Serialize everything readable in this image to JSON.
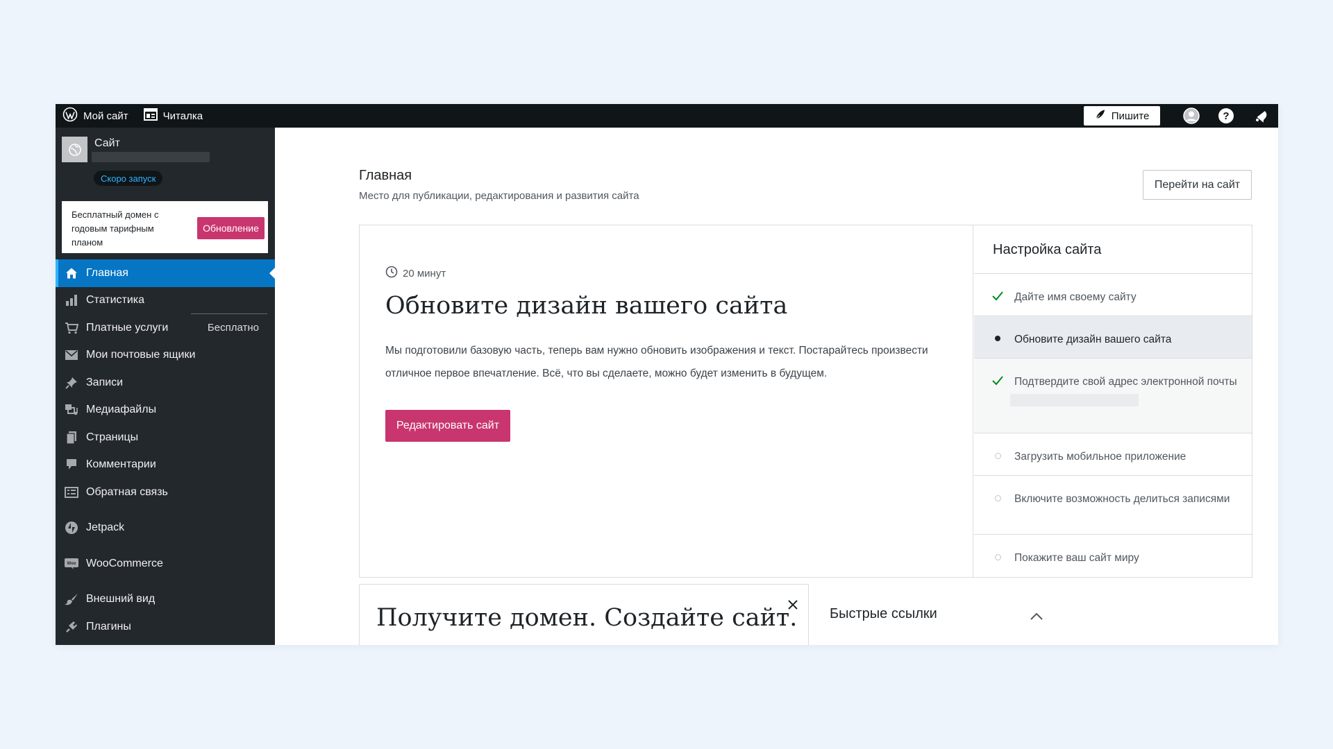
{
  "topbar": {
    "my_site_label": "Мой сайт",
    "reader_label": "Читалка",
    "write_label": "Пишите",
    "icons": [
      "wordpress-logo-icon",
      "reader-icon",
      "pen-icon",
      "user-avatar-icon",
      "help-icon",
      "notifications-icon"
    ]
  },
  "sidebar": {
    "site_name": "Сайт",
    "launch_badge": "Скоро запуск",
    "promo_text": "Бесплатный домен с годовым тарифным планом",
    "promo_button": "Обновление",
    "items": [
      {
        "label": "Главная",
        "icon": "home-icon",
        "active": true
      },
      {
        "label": "Статистика",
        "icon": "stats-icon"
      },
      {
        "label": "Платные услуги",
        "icon": "cart-icon",
        "note": "Бесплатно"
      },
      {
        "label": "Мои почтовые ящики",
        "icon": "mail-icon"
      },
      {
        "label": "Записи",
        "icon": "pin-icon"
      },
      {
        "label": "Медиафайлы",
        "icon": "media-icon"
      },
      {
        "label": "Страницы",
        "icon": "pages-icon"
      },
      {
        "label": "Комментарии",
        "icon": "comment-icon"
      },
      {
        "label": "Обратная связь",
        "icon": "feedback-icon"
      },
      {
        "label": "Jetpack",
        "icon": "jetpack-icon"
      },
      {
        "label": "WooCommerce",
        "icon": "woo-icon"
      },
      {
        "label": "Внешний вид",
        "icon": "brush-icon"
      },
      {
        "label": "Плагины",
        "icon": "plugin-icon"
      }
    ]
  },
  "main": {
    "title": "Главная",
    "subtitle": "Место для публикации, редактирования и развития сайта",
    "goto_button": "Перейти на сайт",
    "task": {
      "time": "20 минут",
      "title": "Обновите дизайн вашего сайта",
      "description": "Мы подготовили базовую часть, теперь вам нужно обновить изображения и текст. Постарайтесь произвести отличное первое впечатление. Всё, что вы сделаете, можно будет изменить в будущем.",
      "button": "Редактировать сайт"
    },
    "checklist": {
      "title": "Настройка сайта",
      "items": [
        {
          "label": "Дайте имя своему сайту",
          "status": "done"
        },
        {
          "label": "Обновите дизайн вашего сайта",
          "status": "current"
        },
        {
          "label": "Подтвердите свой адрес электронной почты",
          "status": "done"
        },
        {
          "label": "Загрузить мобильное приложение",
          "status": "todo"
        },
        {
          "label": "Включите возможность делиться записями",
          "status": "todo"
        },
        {
          "label": "Покажите ваш сайт миру",
          "status": "todo"
        }
      ]
    },
    "domain_card": {
      "title": "Получите домен. Создайте сайт."
    },
    "quick_links": {
      "title": "Быстрые ссылки"
    }
  },
  "colors": {
    "admin_bar": "#101517",
    "sidebar": "#23282d",
    "active_nav": "#0675c4",
    "accent_pink": "#c9356e",
    "check_green": "#008a20",
    "page_background": "#eef4fb"
  }
}
